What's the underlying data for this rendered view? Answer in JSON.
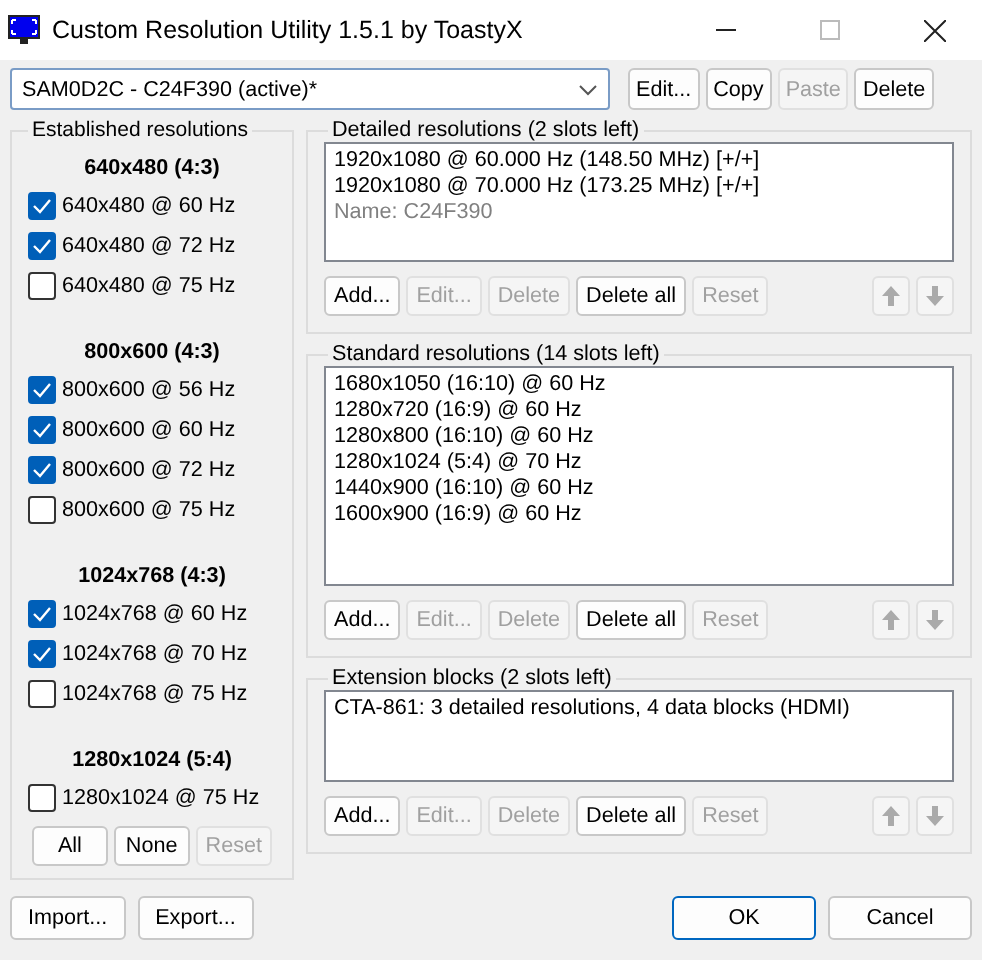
{
  "window": {
    "title": "Custom Resolution Utility 1.5.1 by ToastyX"
  },
  "monitor": {
    "value": "SAM0D2C - C24F390 (active)*",
    "buttons": [
      {
        "label": "Edit...",
        "disabled": false
      },
      {
        "label": "Copy",
        "disabled": false
      },
      {
        "label": "Paste",
        "disabled": true
      },
      {
        "label": "Delete",
        "disabled": false
      }
    ]
  },
  "established": {
    "title": "Established resolutions",
    "groups": [
      {
        "heading": "640x480 (4:3)",
        "items": [
          {
            "label": "640x480 @ 60 Hz",
            "checked": true
          },
          {
            "label": "640x480 @ 72 Hz",
            "checked": true
          },
          {
            "label": "640x480 @ 75 Hz",
            "checked": false
          }
        ]
      },
      {
        "heading": "800x600 (4:3)",
        "items": [
          {
            "label": "800x600 @ 56 Hz",
            "checked": true
          },
          {
            "label": "800x600 @ 60 Hz",
            "checked": true
          },
          {
            "label": "800x600 @ 72 Hz",
            "checked": true
          },
          {
            "label": "800x600 @ 75 Hz",
            "checked": false
          }
        ]
      },
      {
        "heading": "1024x768 (4:3)",
        "items": [
          {
            "label": "1024x768 @ 60 Hz",
            "checked": true
          },
          {
            "label": "1024x768 @ 70 Hz",
            "checked": true
          },
          {
            "label": "1024x768 @ 75 Hz",
            "checked": false
          }
        ]
      },
      {
        "heading": "1280x1024 (5:4)",
        "items": [
          {
            "label": "1280x1024 @ 75 Hz",
            "checked": false
          }
        ]
      }
    ],
    "buttons": [
      {
        "label": "All",
        "disabled": false
      },
      {
        "label": "None",
        "disabled": false
      },
      {
        "label": "Reset",
        "disabled": true
      }
    ]
  },
  "sections": [
    {
      "title": "Detailed resolutions (2 slots left)",
      "items": [
        {
          "text": "1920x1080 @ 60.000 Hz (148.50 MHz) [+/+]",
          "kind": "entry"
        },
        {
          "text": "1920x1080 @ 70.000 Hz (173.25 MHz) [+/+]",
          "kind": "entry"
        },
        {
          "text": "Name: C24F390",
          "kind": "note"
        }
      ],
      "buttons": [
        {
          "label": "Add...",
          "disabled": false
        },
        {
          "label": "Edit...",
          "disabled": true
        },
        {
          "label": "Delete",
          "disabled": true
        },
        {
          "label": "Delete all",
          "disabled": false
        },
        {
          "label": "Reset",
          "disabled": true
        }
      ],
      "move_buttons": [
        {
          "kind": "up",
          "disabled": true
        },
        {
          "kind": "down",
          "disabled": true
        }
      ]
    },
    {
      "title": "Standard resolutions (14 slots left)",
      "items": [
        {
          "text": "1680x1050 (16:10) @ 60 Hz",
          "kind": "entry"
        },
        {
          "text": "1280x720 (16:9) @ 60 Hz",
          "kind": "entry"
        },
        {
          "text": "1280x800 (16:10) @ 60 Hz",
          "kind": "entry"
        },
        {
          "text": "1280x1024 (5:4) @ 70 Hz",
          "kind": "entry"
        },
        {
          "text": "1440x900 (16:10) @ 60 Hz",
          "kind": "entry"
        },
        {
          "text": "1600x900 (16:9) @ 60 Hz",
          "kind": "entry"
        }
      ],
      "buttons": [
        {
          "label": "Add...",
          "disabled": false
        },
        {
          "label": "Edit...",
          "disabled": true
        },
        {
          "label": "Delete",
          "disabled": true
        },
        {
          "label": "Delete all",
          "disabled": false
        },
        {
          "label": "Reset",
          "disabled": true
        }
      ],
      "move_buttons": [
        {
          "kind": "up",
          "disabled": true
        },
        {
          "kind": "down",
          "disabled": true
        }
      ]
    },
    {
      "title": "Extension blocks (2 slots left)",
      "items": [
        {
          "text": "CTA-861: 3 detailed resolutions, 4 data blocks (HDMI)",
          "kind": "entry"
        }
      ],
      "buttons": [
        {
          "label": "Add...",
          "disabled": false
        },
        {
          "label": "Edit...",
          "disabled": true
        },
        {
          "label": "Delete",
          "disabled": true
        },
        {
          "label": "Delete all",
          "disabled": false
        },
        {
          "label": "Reset",
          "disabled": true
        }
      ],
      "move_buttons": [
        {
          "kind": "up",
          "disabled": true
        },
        {
          "kind": "down",
          "disabled": true
        }
      ]
    }
  ],
  "footer": {
    "left": [
      {
        "label": "Import...",
        "default": false
      },
      {
        "label": "Export...",
        "default": false
      }
    ],
    "right": [
      {
        "label": "OK",
        "default": true
      },
      {
        "label": "Cancel",
        "default": false
      }
    ]
  }
}
